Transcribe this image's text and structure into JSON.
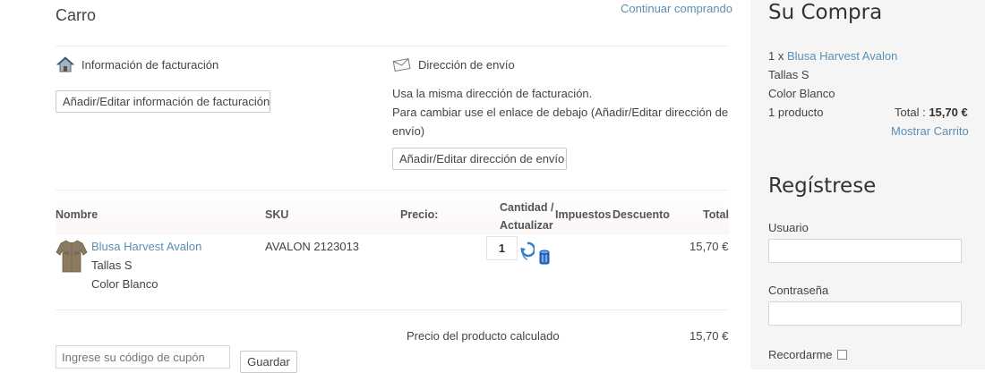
{
  "cart": {
    "title": "Carro",
    "continue_link": "Continuar comprando",
    "billing": {
      "label": "Información de facturación",
      "button": "Añadir/Editar información de facturación"
    },
    "shipping": {
      "label": "Dirección de envío",
      "note_line1": "Usa la misma dirección de facturación.",
      "note_line2": "Para cambiar use el enlace de debajo (Añadir/Editar dirección de",
      "note_line3": "envío)",
      "button": "Añadir/Editar dirección de envío"
    },
    "table": {
      "headers": {
        "name": "Nombre",
        "sku": "SKU",
        "price": "Precio:",
        "qty_line1": "Cantidad /",
        "qty_line2": "Actualizar",
        "tax": "Impuestos",
        "discount": "Descuento",
        "total": "Total"
      },
      "rows": [
        {
          "name": "Blusa Harvest Avalon",
          "size": "Tallas S",
          "color": "Color Blanco",
          "sku": "AVALON 2123013",
          "quantity": "1",
          "total": "15,70 €"
        }
      ],
      "subtotal_label": "Precio del producto calculado",
      "subtotal_value": "15,70 €"
    },
    "coupon": {
      "placeholder": "Ingrese su código de cupón",
      "button": "Guardar"
    }
  },
  "sidebar": {
    "purchase": {
      "title": "Su Compra",
      "qty_prefix": "1 x",
      "product_link": "Blusa Harvest Avalon",
      "size": "Tallas S",
      "color": "Color Blanco",
      "count": "1 producto",
      "total_label": "Total :",
      "total_value": "15,70 €",
      "show_cart": "Mostrar Carrito"
    },
    "register": {
      "title": "Regístrese",
      "username_label": "Usuario",
      "password_label": "Contraseña",
      "remember_label": "Recordarme"
    }
  }
}
